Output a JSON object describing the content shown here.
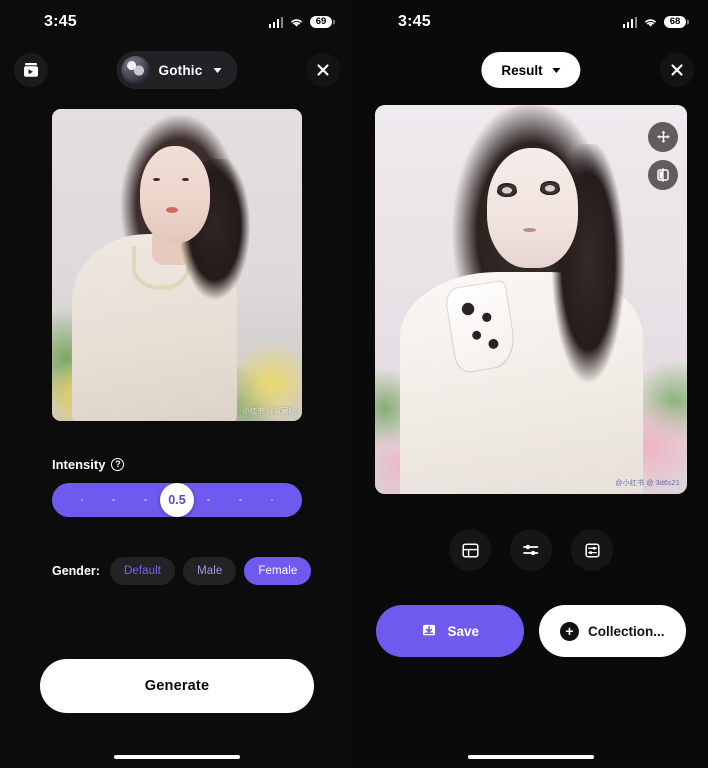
{
  "left": {
    "status": {
      "time": "3:45",
      "battery": "69",
      "signal_icon": "cellular-signal-icon",
      "wifi_icon": "wifi-icon"
    },
    "header": {
      "gallery_icon": "gallery-icon",
      "style_name": "Gothic",
      "style_avatar": "style-avatar",
      "close_icon": "close-icon"
    },
    "photo": {
      "watermark": "小红书 @收藏吧"
    },
    "intensity": {
      "label": "Intensity",
      "help_icon": "help-circle-icon",
      "value": "0.5",
      "ticks": [
        "",
        "",
        "",
        "",
        "",
        "",
        ""
      ]
    },
    "gender": {
      "label": "Gender:",
      "options": [
        {
          "label": "Default",
          "selected": false
        },
        {
          "label": "Male",
          "selected": false
        },
        {
          "label": "Female",
          "selected": true
        }
      ]
    },
    "generate_button": "Generate"
  },
  "right": {
    "status": {
      "time": "3:45",
      "battery": "68",
      "signal_icon": "cellular-signal-icon",
      "wifi_icon": "wifi-icon"
    },
    "header": {
      "title": "Result",
      "close_icon": "close-icon"
    },
    "result_image": {
      "watermark": "@小红书 \n@ 3d6s21",
      "float_buttons": [
        {
          "icon": "move-arrows-icon"
        },
        {
          "icon": "compare-split-icon"
        }
      ]
    },
    "tools": [
      {
        "icon": "layout-template-icon"
      },
      {
        "icon": "sliders-adjust-icon"
      },
      {
        "icon": "framed-settings-icon"
      }
    ],
    "actions": [
      {
        "label": "Save",
        "icon": "download-save-icon",
        "style": "primary"
      },
      {
        "label": "Collection...",
        "icon": "plus-circle-icon",
        "style": "light"
      }
    ]
  },
  "colors": {
    "accent_purple": "#6f5af0",
    "background": "#0b0b0c",
    "chip_bg": "#232326",
    "white": "#ffffff"
  }
}
